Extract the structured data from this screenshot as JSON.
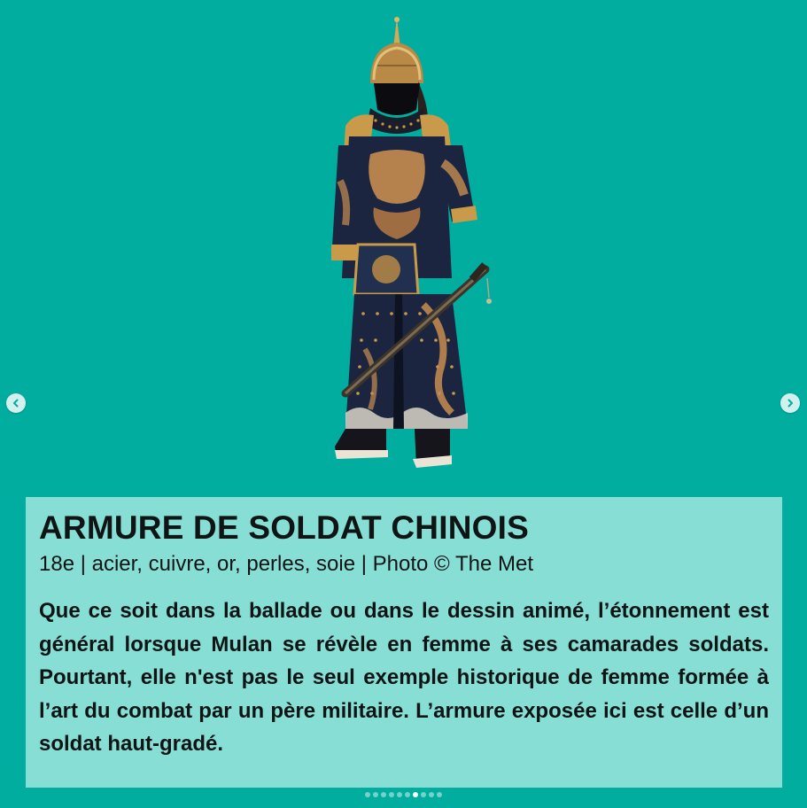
{
  "post": {
    "title": "ARMURE DE SOLDAT CHINOIS",
    "subtitle": "18e | acier, cuivre, or, perles, soie | Photo © The Met",
    "body": "Que ce soit dans la ballade ou dans le dessin animé, l’étonnement est général lorsque Mulan se révèle en femme à ses camarades soldats. Pourtant, elle n'est pas le seul exemple historique de femme formée à l’art du combat par un père militaire. L’armure exposée ici est celle d’un soldat haut-gradé."
  },
  "carousel": {
    "prev_icon": "chevron-left-icon",
    "next_icon": "chevron-right-icon",
    "slide_count": 10,
    "active_index": 6
  },
  "colors": {
    "background": "#00ad9f",
    "caption_background": "#86ded4",
    "text": "#0f1414",
    "armor_navy": "#1b2540",
    "armor_gold": "#c99a4a"
  }
}
